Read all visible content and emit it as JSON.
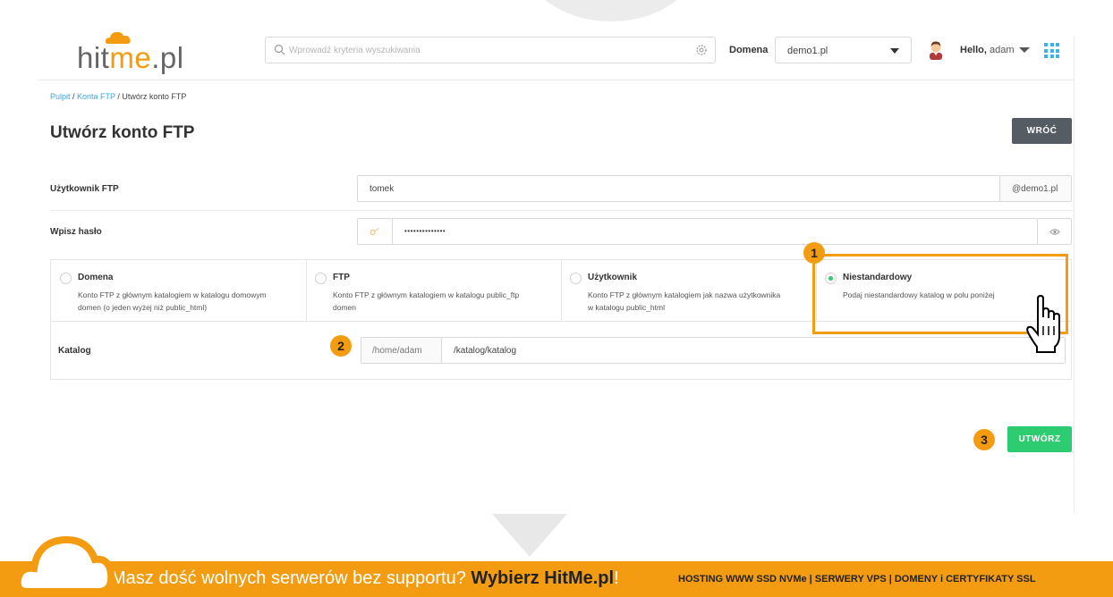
{
  "header": {
    "logo": {
      "part1": "hit",
      "part2": "me",
      "part3": ".pl"
    },
    "search": {
      "placeholder": "Wprowadź kryteria wyszukiwania"
    },
    "domain_label": "Domena",
    "domain_value": "demo1.pl",
    "greeting_prefix": "Hello,",
    "greeting_user": "adam"
  },
  "breadcrumb": {
    "item1": "Pulpit",
    "sep": " / ",
    "item2": "Konta FTP",
    "item3": "Utwórz konto FTP"
  },
  "page": {
    "title": "Utwórz konto FTP",
    "back_button": "WRÓĆ"
  },
  "form": {
    "user_label": "Użytkownik FTP",
    "user_value": "tomek",
    "user_suffix": "@demo1.pl",
    "password_label": "Wpisz hasło",
    "password_mask": "••••••••••••••",
    "options": [
      {
        "title": "Domena",
        "desc1": "Konto FTP z głównym katalogiem w katalogu domowym",
        "desc2": "domen (o jeden wyżej niż public_html)",
        "selected": false
      },
      {
        "title": "FTP",
        "desc1": "Konto FTP z głównym katalogiem w katalogu public_ftp",
        "desc2": "domen",
        "selected": false
      },
      {
        "title": "Użytkownik",
        "desc1": "Konto FTP z głównym katalogiem jak nazwa użytkownika",
        "desc2": "w katalogu public_html",
        "selected": false
      },
      {
        "title": "Niestandardowy",
        "desc1": "Podaj niestandardowy katalog w polu poniżej",
        "desc2": "",
        "selected": true
      }
    ],
    "catalog_label": "Katalog",
    "catalog_prefix": "/home/adam",
    "catalog_value": "/katalog/katalog",
    "create_button": "UTWÓRZ"
  },
  "badges": {
    "one": "1",
    "two": "2",
    "three": "3"
  },
  "banner": {
    "text_prefix": "Masz dość wolnych serwerów bez supportu?",
    "text_strong": "Wybierz HitMe.pl",
    "text_suffix": "!",
    "right": "HOSTING WWW SSD NVMe | SERWERY VPS | DOMENY i CERTYFIKATY SSL"
  },
  "colors": {
    "accent": "#f39c12",
    "green": "#2ecc71",
    "link": "#3aa5dc",
    "dark_button": "#555c63"
  }
}
